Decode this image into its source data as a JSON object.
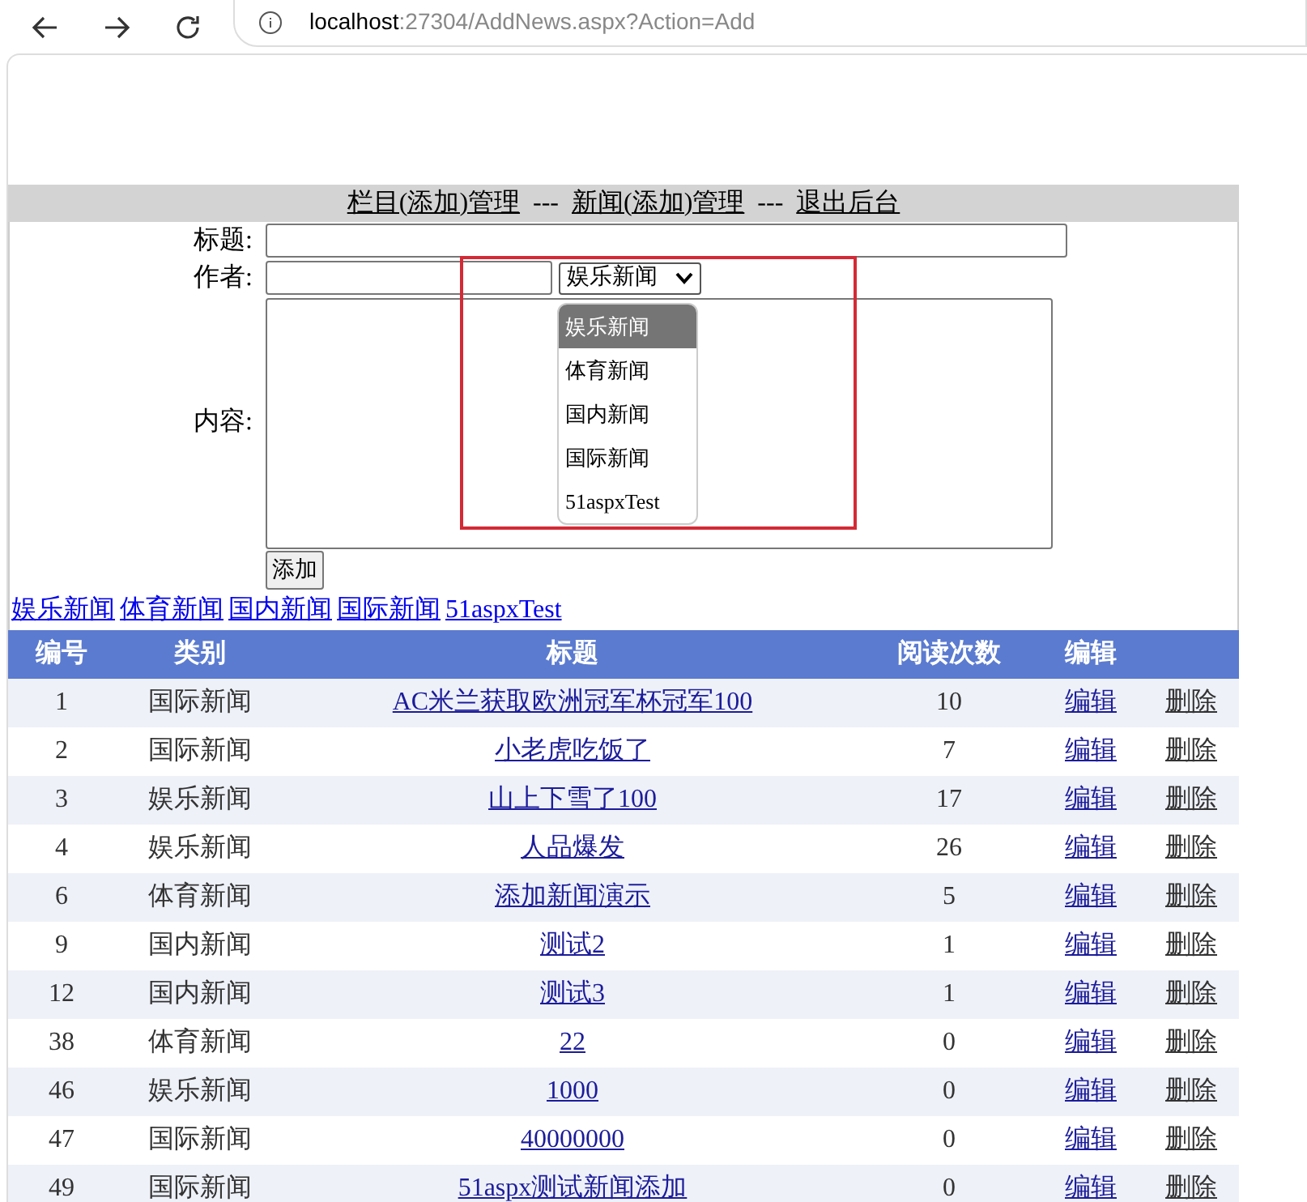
{
  "browser": {
    "url_host": "localhost",
    "url_rest": ":27304/AddNews.aspx?Action=Add"
  },
  "nav": [
    {
      "label": "栏目(添加)管理"
    },
    {
      "label": "---",
      "kind": "separator"
    },
    {
      "label": "新闻(添加)管理"
    },
    {
      "label": "---",
      "kind": "separator"
    },
    {
      "label": "退出后台"
    }
  ],
  "form": {
    "title_label": "标题:",
    "author_label": "作者:",
    "content_label": "内容:",
    "category_select": {
      "value": "娱乐新闻",
      "expanded": true,
      "options": [
        {
          "label": "娱乐新闻",
          "selected": true
        },
        {
          "label": "体育新闻",
          "selected": false
        },
        {
          "label": "国内新闻",
          "selected": false
        },
        {
          "label": "国际新闻",
          "selected": false
        },
        {
          "label": "51aspxTest",
          "selected": false
        }
      ]
    },
    "submit": "添加"
  },
  "category_links": [
    "娱乐新闻",
    "体育新闻",
    "国内新闻",
    "国际新闻",
    "51aspxTest"
  ],
  "table": {
    "columns": [
      "编号",
      "类别",
      "标题",
      "阅读次数",
      "编辑"
    ],
    "rows": [
      {
        "id": "1",
        "category": "国际新闻",
        "title": "AC米兰获取欧洲冠军杯冠军100",
        "reads": "10",
        "edit": "编辑",
        "delete": "删除"
      },
      {
        "id": "2",
        "category": "国际新闻",
        "title": "小老虎吃饭了",
        "reads": "7",
        "edit": "编辑",
        "delete": "删除"
      },
      {
        "id": "3",
        "category": "娱乐新闻",
        "title": "山上下雪了100",
        "reads": "17",
        "edit": "编辑",
        "delete": "删除"
      },
      {
        "id": "4",
        "category": "娱乐新闻",
        "title": "人品爆发",
        "reads": "26",
        "edit": "编辑",
        "delete": "删除"
      },
      {
        "id": "6",
        "category": "体育新闻",
        "title": "添加新闻演示",
        "reads": "5",
        "edit": "编辑",
        "delete": "删除"
      },
      {
        "id": "9",
        "category": "国内新闻",
        "title": "测试2",
        "reads": "1",
        "edit": "编辑",
        "delete": "删除"
      },
      {
        "id": "12",
        "category": "国内新闻",
        "title": "测试3",
        "reads": "1",
        "edit": "编辑",
        "delete": "删除"
      },
      {
        "id": "38",
        "category": "体育新闻",
        "title": "22",
        "reads": "0",
        "edit": "编辑",
        "delete": "删除"
      },
      {
        "id": "46",
        "category": "娱乐新闻",
        "title": "1000",
        "reads": "0",
        "edit": "编辑",
        "delete": "删除"
      },
      {
        "id": "47",
        "category": "国际新闻",
        "title": "40000000",
        "reads": "0",
        "edit": "编辑",
        "delete": "删除"
      },
      {
        "id": "49",
        "category": "国际新闻",
        "title": "51aspx测试新闻添加",
        "reads": "0",
        "edit": "编辑",
        "delete": "删除"
      }
    ]
  }
}
